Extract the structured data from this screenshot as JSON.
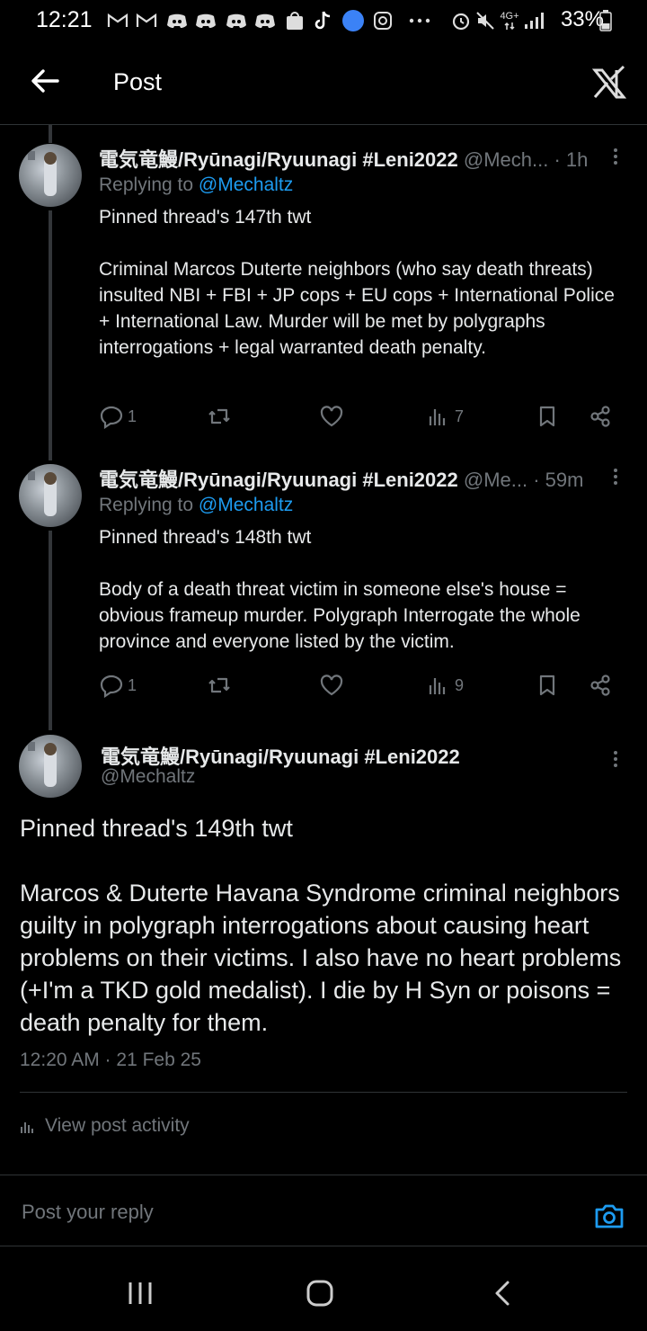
{
  "status_bar": {
    "time": "12:21",
    "battery": "33%",
    "network": "4G+"
  },
  "header": {
    "title": "Post"
  },
  "thread_posts": [
    {
      "name": "電気竜鰻/Ryūnagi/Ryuunagi #Leni2022",
      "handle": "@Mech...",
      "time": "· 1h",
      "replying_prefix": "Replying to ",
      "replying_to": "@Mechaltz",
      "text": "Pinned thread's 147th twt\n\nCriminal Marcos Duterte neighbors (who say death threats) insulted NBI + FBI + JP cops + EU cops + International Police + International Law. Murder will be met by polygraphs interrogations + legal warranted death penalty.",
      "replies": "1",
      "reposts": "",
      "likes": "",
      "views": "7"
    },
    {
      "name": "電気竜鰻/Ryūnagi/Ryuunagi #Leni2022",
      "handle": "@Me...",
      "time": "· 59m",
      "replying_prefix": "Replying to ",
      "replying_to": "@Mechaltz",
      "text": "Pinned thread's 148th twt\n\nBody of a death threat victim in someone else's house = obvious frameup murder. Polygraph Interrogate the whole province and everyone listed by the victim.",
      "replies": "1",
      "reposts": "",
      "likes": "",
      "views": "9"
    }
  ],
  "main_post": {
    "name": "電気竜鰻/Ryūnagi/Ryuunagi #Leni2022",
    "handle": "@Mechaltz",
    "text": "Pinned thread's 149th twt\n\nMarcos & Duterte Havana Syndrome criminal neighbors guilty in polygraph interrogations about causing heart problems on their victims. I also have no heart problems (+I'm a TKD gold medalist). I die by H Syn or poisons = death penalty for them.",
    "timestamp": "12:20 AM · 21 Feb 25",
    "view_activity": "View post activity"
  },
  "reply": {
    "placeholder": "Post your reply"
  },
  "colors": {
    "background": "#000000",
    "text": "#e7e9ea",
    "muted": "#71767b",
    "accent": "#1d9bf0",
    "divider": "#2f3336"
  }
}
